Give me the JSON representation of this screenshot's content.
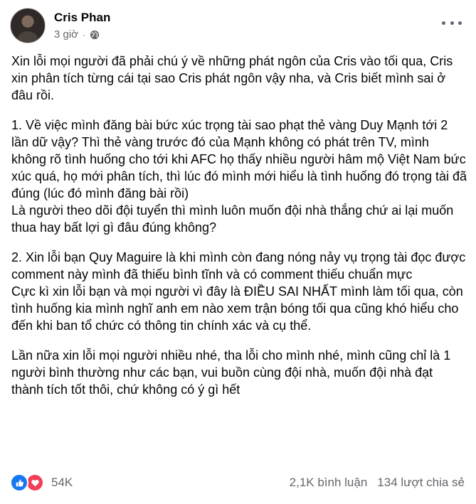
{
  "post": {
    "author": "Cris Phan",
    "time": "3 giờ",
    "privacy_icon": "globe-icon",
    "paragraphs": [
      "Xin lỗi mọi người đã phải chú ý về những phát ngôn của Cris vào tối qua, Cris xin phân tích từng cái tại sao Cris phát ngôn vậy nha, và Cris biết mình sai ở đâu rồi.",
      "1. Về việc mình đăng bài bức xúc trọng tài sao phạt thẻ vàng Duy Mạnh tới 2 lần dữ vậy? Thì thẻ vàng trước đó của Mạnh không có phát trên TV, mình không rõ tình huống cho tới khi AFC họ thấy nhiều người hâm mộ Việt Nam bức xúc quá, họ mới phân tích, thì lúc đó mình mới hiểu là tình huống đó trọng tài đã đúng (lúc đó mình đăng bài rồi)\nLà người theo dõi đội tuyển thì mình luôn muốn đội nhà thắng chứ ai lại muốn thua hay bất lợi gì đâu đúng không?",
      "2. Xin lỗi bạn Quy Maguire là khi mình còn đang nóng nảy vụ trọng tài đọc được comment này mình đã thiếu bình tĩnh và có comment thiếu chuẩn mực\nCực kì xin lỗi bạn và mọi người vì đây là ĐIỀU SAI NHẤT mình làm tối qua, còn tình huống kia mình nghĩ anh em nào xem trận bóng tối qua cũng khó hiểu cho đến khi ban tổ chức có thông tin chính xác và cụ thể.",
      "Lần nữa xin lỗi mọi người nhiều nhé, tha lỗi cho mình nhé, mình cũng chỉ là 1 người bình thường như các bạn, vui buồn cùng đội nhà, muốn đội nhà đạt thành tích tốt thôi, chứ không có ý gì hết"
    ],
    "reactions_count": "54K",
    "comments_count": "2,1K bình luận",
    "shares_count": "134 lượt chia sẻ",
    "colors": {
      "like": "#1877f2",
      "love": "#f33e58",
      "secondary_text": "#65676b"
    }
  }
}
